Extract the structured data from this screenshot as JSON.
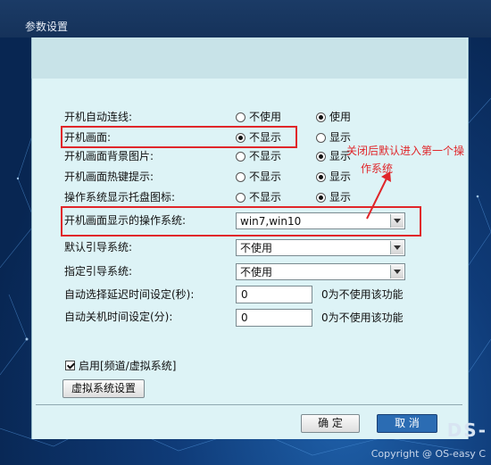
{
  "window": {
    "title": "参数设置"
  },
  "settings": [
    {
      "label": "开机自动连线:",
      "opt1": "不使用",
      "opt2": "使用",
      "selected": 2
    },
    {
      "label": "开机画面:",
      "opt1": "不显示",
      "opt2": "显示",
      "selected": 1
    },
    {
      "label": "开机画面背景图片:",
      "opt1": "不显示",
      "opt2": "显示",
      "selected": 2
    },
    {
      "label": "开机画面热键提示:",
      "opt1": "不显示",
      "opt2": "显示",
      "selected": 2
    },
    {
      "label": "操作系统显示托盘图标:",
      "opt1": "不显示",
      "opt2": "显示",
      "selected": 2
    }
  ],
  "os_display": {
    "label": "开机画面显示的操作系统:",
    "value": "win7,win10"
  },
  "default_boot": {
    "label": "默认引导系统:",
    "value": "不使用"
  },
  "specified_boot": {
    "label": "指定引导系统:",
    "value": "不使用"
  },
  "auto_select_delay": {
    "label": "自动选择延迟时间设定(秒):",
    "value": "0",
    "hint": "0为不使用该功能"
  },
  "auto_shutdown": {
    "label": "自动关机时间设定(分):",
    "value": "0",
    "hint": "0为不使用该功能"
  },
  "annotation": {
    "line1": "关闭后默认进入第一个操",
    "line2": "作系统"
  },
  "virtual": {
    "checkbox_label": "启用[频道/虚拟系统]",
    "checked": true,
    "settings_button": "虚拟系统设置"
  },
  "buttons": {
    "ok": "确 定",
    "cancel": "取 消"
  },
  "footer": {
    "copyright": "Copyright @ OS-easy C",
    "logo": "DS-"
  },
  "colors": {
    "annotation_red": "#e0262a",
    "primary_button": "#2b6cb3",
    "dialog_bg": "#ddf3f6"
  }
}
